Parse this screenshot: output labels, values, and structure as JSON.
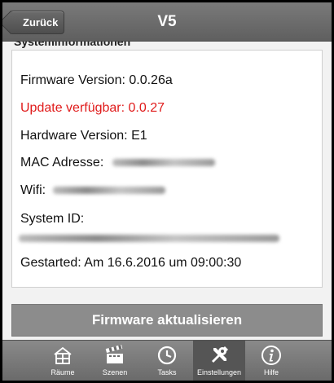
{
  "header": {
    "back_label": "Zurück",
    "title": "V5"
  },
  "section": {
    "legend": "Systeminformationen"
  },
  "info": {
    "firmware": "Firmware Version: 0.0.26a",
    "update": "Update verfügbar: 0.0.27",
    "hardware": "Hardware Version: E1",
    "mac_label": "MAC Adresse:",
    "wifi_label": "Wifi:",
    "system_id_label": "System ID:",
    "started": "Gestarted: Am 16.6.2016 um 09:00:30"
  },
  "actions": {
    "firmware_update_label": "Firmware aktualisieren"
  },
  "tabs": [
    {
      "label": "Räume",
      "icon": "house-icon"
    },
    {
      "label": "Szenen",
      "icon": "clapperboard-icon"
    },
    {
      "label": "Tasks",
      "icon": "clock-icon"
    },
    {
      "label": "Einstellungen",
      "icon": "wrench-screwdriver-icon",
      "active": true
    },
    {
      "label": "Hilfe",
      "icon": "info-icon"
    }
  ],
  "colors": {
    "update_text": "#e01b1b",
    "header_bg": "#6b6b6b",
    "button_bg": "#8c8c8c",
    "active_tab_bg": "#555555"
  }
}
